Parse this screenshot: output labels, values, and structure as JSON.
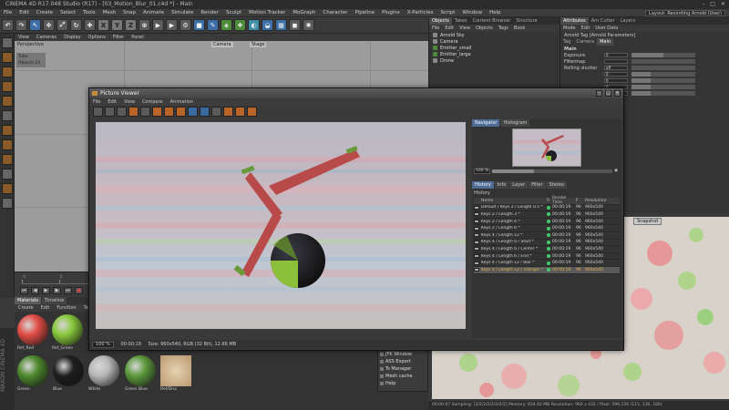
{
  "app": {
    "title": "CINEMA 4D R17.048 Studio (R17) - [03_Motion_Blur_01.c4d *] - Main",
    "window_controls": [
      "–",
      "□",
      "✕"
    ],
    "layout_label": "Layout:",
    "layout_value": "Recording Arnold (User)"
  },
  "menubar": [
    "File",
    "Edit",
    "Create",
    "Select",
    "Tools",
    "Mesh",
    "Snap",
    "Animate",
    "Simulate",
    "Render",
    "Sculpt",
    "Motion Tracker",
    "MoGraph",
    "Character",
    "Pipeline",
    "Plugins",
    "X-Particles",
    "Script",
    "Window",
    "Help"
  ],
  "toolbar": {
    "buttons": [
      {
        "name": "undo-icon",
        "glyph": "↶",
        "style": ""
      },
      {
        "name": "redo-icon",
        "glyph": "↷",
        "style": ""
      },
      {
        "name": "live-select-icon",
        "glyph": "↖",
        "style": "blue"
      },
      {
        "name": "move-icon",
        "glyph": "✥",
        "style": ""
      },
      {
        "name": "scale-icon",
        "glyph": "⤢",
        "style": ""
      },
      {
        "name": "rotate-icon",
        "glyph": "↻",
        "style": ""
      },
      {
        "name": "recent-tools-icon",
        "glyph": "✚",
        "style": ""
      },
      {
        "name": "x-axis-icon",
        "glyph": "X",
        "style": "xyz"
      },
      {
        "name": "y-axis-icon",
        "glyph": "Y",
        "style": "xyz"
      },
      {
        "name": "z-axis-icon",
        "glyph": "Z",
        "style": "xyz"
      },
      {
        "name": "coordinate-system-icon",
        "glyph": "⊕",
        "style": ""
      },
      {
        "name": "render-view-icon",
        "glyph": "▶",
        "style": ""
      },
      {
        "name": "render-picture-viewer-icon",
        "glyph": "▶",
        "style": ""
      },
      {
        "name": "render-settings-icon",
        "glyph": "⚙",
        "style": ""
      },
      {
        "name": "cube-icon",
        "glyph": "■",
        "style": "blue"
      },
      {
        "name": "pen-icon",
        "glyph": "✎",
        "style": "blue"
      },
      {
        "name": "subdivision-icon",
        "glyph": "◈",
        "style": "green"
      },
      {
        "name": "array-icon",
        "glyph": "❖",
        "style": "green"
      },
      {
        "name": "deformer-icon",
        "glyph": "◐",
        "style": "cyan"
      },
      {
        "name": "environment-icon",
        "glyph": "◒",
        "style": "blue"
      },
      {
        "name": "floor-icon",
        "glyph": "▦",
        "style": "blue"
      },
      {
        "name": "camera-icon",
        "glyph": "◼",
        "style": ""
      },
      {
        "name": "light-icon",
        "glyph": "✺",
        "style": ""
      }
    ]
  },
  "viewport": {
    "menu": [
      "View",
      "Cameras",
      "Display",
      "Options",
      "Filter",
      "Panel"
    ],
    "label": "Perspective",
    "camera_tab": "Camera",
    "stage_tab": "Stage",
    "side_object_line1": "Tube",
    "side_object_line2": "Objects 24"
  },
  "timeline": {
    "ticks": [
      "0",
      "5",
      "10",
      "15",
      "20",
      "25",
      "30",
      "35",
      "40",
      "45",
      "50"
    ],
    "frame_field": "0 F"
  },
  "materials": {
    "tabs": [
      "Materials",
      "Timeline"
    ],
    "menu": [
      "Create",
      "Edit",
      "Function",
      "Tex"
    ],
    "items": [
      {
        "name": "Ref_Red",
        "color": "#e24d45"
      },
      {
        "name": "Ref_Green",
        "color": "#88c83a"
      },
      {
        "name": "Green",
        "color": "#4e8a2e"
      },
      {
        "name": "Blue",
        "color": "#1e1e1e"
      },
      {
        "name": "White",
        "color": "#b8b8b8"
      },
      {
        "name": "Green Blue",
        "color": "#5c9a3c"
      },
      {
        "name": "Ref/Disc",
        "color": "#d2b48c"
      }
    ],
    "brand": "MAXON CINEMA 4D"
  },
  "objects": {
    "tabs": [
      "Objects",
      "Takes",
      "Content Browser",
      "Structure"
    ],
    "menu": [
      "File",
      "Edit",
      "View",
      "Objects",
      "Tags",
      "Book"
    ],
    "rows": [
      "Arnold Sky",
      "Camera",
      "Emitter_small",
      "Emitter_large",
      "Drone"
    ]
  },
  "attributes": {
    "tabs": [
      "Attributes",
      "Arn Cutter",
      "Layers"
    ],
    "menu": [
      "Mode",
      "Edit",
      "User Data"
    ],
    "header": "Arnold Tag [Arnold Parameters]",
    "subtabs": [
      "Tag",
      "Camera",
      "Main"
    ],
    "section": "Main",
    "rows": [
      {
        "label": "Exposure",
        "value": "0",
        "fill": 0.5
      },
      {
        "label": "Filtermap",
        "value": "",
        "fill": 0
      },
      {
        "label": "Rolling shutter",
        "value": "off",
        "fill": 0
      },
      {
        "label": "",
        "value": "0",
        "fill": 0.3
      },
      {
        "label": "",
        "value": "0",
        "fill": 0.3
      },
      {
        "label": "",
        "value": "0",
        "fill": 0.3
      },
      {
        "label": "",
        "value": "0",
        "fill": 0.3
      }
    ]
  },
  "render_panel": {
    "snapshot": "Snapshot"
  },
  "status_bar": "00:00:07  Sampling: [3/2/2/2/2/2/2/2]  Memory: 834.92 MB  Resolution: 960 x 432 / Pixel: 596,156 (115, 136, 180)",
  "plugin_menu": [
    "JFK Window",
    "ASS Export",
    "Ts Manager",
    "Mesh cache",
    "Help"
  ],
  "picture_viewer": {
    "title": "Picture Viewer",
    "window_controls": [
      "–",
      "□",
      "✕"
    ],
    "menu": [
      "File",
      "Edit",
      "View",
      "Compare",
      "Animation"
    ],
    "nav_tabs": [
      "Navigator",
      "Histogram"
    ],
    "zoom_value": "100 %",
    "zoom_fill": 0.35,
    "hist_tabs": [
      "History",
      "Info",
      "Layer",
      "Filter",
      "Stereo"
    ],
    "history_title": "History",
    "columns": {
      "name": "Name",
      "r": "R",
      "render_time": "Render Time",
      "f": "F",
      "resolution": "Resolution"
    },
    "history": [
      {
        "name": "Default / Keys 2 / Length 0.5 *",
        "time": "00:00:19",
        "f": "96",
        "res": "960x540",
        "sel": false
      },
      {
        "name": "Keys 2 / Length 3 *",
        "time": "00:00:19",
        "f": "96",
        "res": "960x540",
        "sel": false
      },
      {
        "name": "Keys 2 / Length 4 *",
        "time": "00:00:19",
        "f": "96",
        "res": "960x540",
        "sel": false
      },
      {
        "name": "Keys 2 / Length 6 *",
        "time": "00:00:19",
        "f": "96",
        "res": "960x540",
        "sel": false
      },
      {
        "name": "Keys 4 / Length 12 *",
        "time": "00:00:19",
        "f": "96",
        "res": "960x540",
        "sel": false
      },
      {
        "name": "Keys 4 / Length 6 / Start *",
        "time": "00:00:19",
        "f": "96",
        "res": "960x540",
        "sel": false
      },
      {
        "name": "Keys 4 / Length 6 / Center *",
        "time": "00:00:19",
        "f": "96",
        "res": "960x540",
        "sel": false
      },
      {
        "name": "Keys 4 / Length 6 / End *",
        "time": "00:00:19",
        "f": "96",
        "res": "960x540",
        "sel": false
      },
      {
        "name": "Keys 4 / Length 12 / Box *",
        "time": "00:00:19",
        "f": "96",
        "res": "960x540",
        "sel": false
      },
      {
        "name": "Keys 4 / Length 12 / Triangle *",
        "time": "00:00:19",
        "f": "96",
        "res": "960x540",
        "sel": true
      }
    ],
    "status": {
      "zoom": "100 %",
      "time": "00:00:19",
      "size": "Size: 960x540, RGB (32 Bit), 12.66 MB"
    }
  }
}
